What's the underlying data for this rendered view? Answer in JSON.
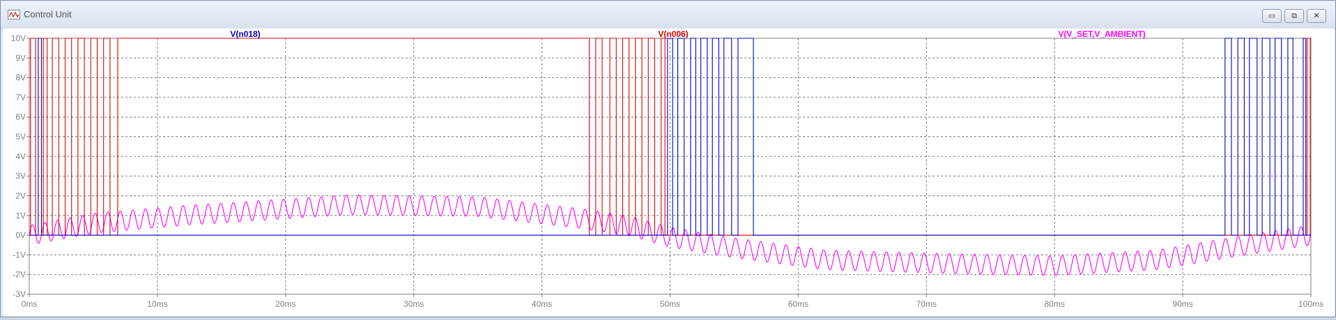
{
  "window": {
    "title": "Control Unit",
    "icon": "waveform-icon",
    "buttons": [
      {
        "name": "minimize-button",
        "glyph": "▭"
      },
      {
        "name": "restore-button",
        "glyph": "⧉"
      },
      {
        "name": "close-button",
        "glyph": "✕"
      }
    ]
  },
  "chart_data": {
    "type": "line",
    "xunit": "ms",
    "xlim": [
      0,
      100
    ],
    "ylim": [
      -3,
      10
    ],
    "grid": true,
    "x_ticks": [
      "0ms",
      "10ms",
      "20ms",
      "30ms",
      "40ms",
      "50ms",
      "60ms",
      "70ms",
      "80ms",
      "90ms",
      "100ms"
    ],
    "y_ticks": [
      "10V",
      "9V",
      "8V",
      "7V",
      "6V",
      "5V",
      "4V",
      "3V",
      "2V",
      "1V",
      "0V",
      "-1V",
      "-2V",
      "-3V"
    ],
    "legend_placement": "top",
    "series": [
      {
        "name": "V(n018)",
        "color": "#0000cc",
        "kind": "digital",
        "low": 0,
        "high": 10,
        "high_intervals": [
          [
            0.7,
            0.95
          ],
          [
            49.8,
            50.2
          ],
          [
            50.6,
            51.1
          ],
          [
            51.6,
            52.0
          ],
          [
            52.4,
            52.9
          ],
          [
            53.3,
            53.8
          ],
          [
            54.2,
            54.8
          ],
          [
            55.3,
            56.5
          ],
          [
            93.3,
            93.8
          ],
          [
            94.3,
            94.8
          ],
          [
            95.2,
            95.8
          ],
          [
            96.2,
            96.8
          ],
          [
            97.2,
            97.7
          ],
          [
            98.2,
            98.6
          ],
          [
            99.4,
            99.6
          ]
        ]
      },
      {
        "name": "V(n006)",
        "color": "#e00000",
        "kind": "digital",
        "low": 0,
        "high": 10,
        "high_intervals": [
          [
            0.1,
            0.5
          ],
          [
            1.1,
            1.4
          ],
          [
            1.8,
            2.3
          ],
          [
            2.8,
            3.3
          ],
          [
            3.8,
            4.3
          ],
          [
            4.8,
            5.3
          ],
          [
            5.8,
            6.3
          ],
          [
            6.9,
            43.7
          ],
          [
            44.2,
            44.7
          ],
          [
            45.3,
            45.8
          ],
          [
            46.3,
            46.8
          ],
          [
            47.3,
            47.8
          ],
          [
            48.3,
            48.8
          ],
          [
            49.3,
            49.6
          ],
          [
            99.7,
            99.95
          ]
        ]
      },
      {
        "name": "V(V_SET,V_AMBIENT)",
        "color": "#ff00ff",
        "kind": "sine",
        "period_ms": 0.98,
        "amplitude_V": 0.5,
        "center_V": [
          [
            0,
            0
          ],
          [
            5,
            0.6
          ],
          [
            12,
            1.0
          ],
          [
            25,
            1.55
          ],
          [
            35,
            1.45
          ],
          [
            43,
            0.85
          ],
          [
            47,
            0.45
          ],
          [
            50,
            -0.1
          ],
          [
            54,
            -0.55
          ],
          [
            62,
            -1.25
          ],
          [
            72,
            -1.45
          ],
          [
            80,
            -1.55
          ],
          [
            88,
            -1.25
          ],
          [
            94,
            -0.6
          ],
          [
            100,
            0
          ]
        ]
      }
    ]
  }
}
